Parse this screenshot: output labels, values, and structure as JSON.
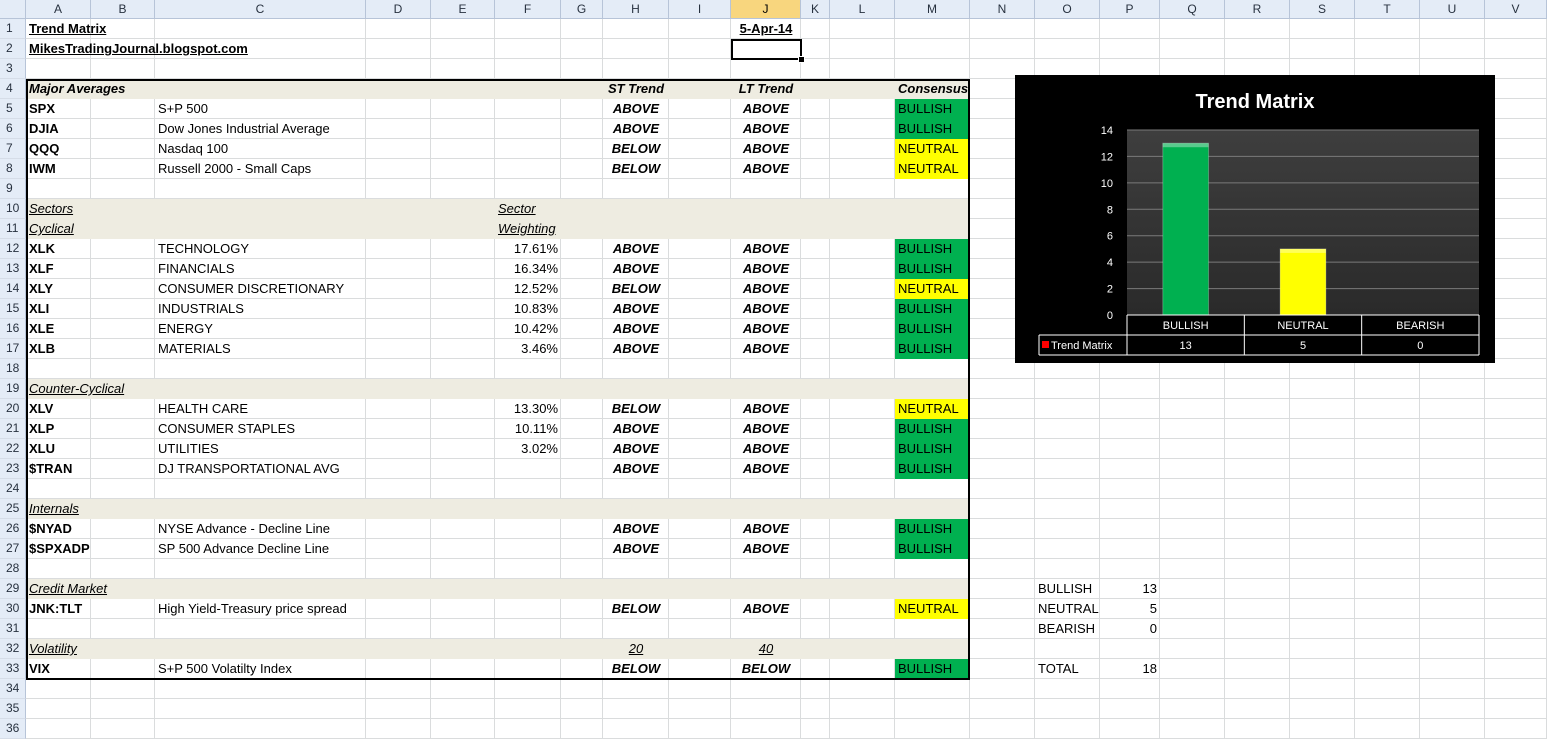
{
  "columns": [
    "A",
    "B",
    "C",
    "D",
    "E",
    "F",
    "G",
    "H",
    "I",
    "J",
    "K",
    "L",
    "M",
    "N",
    "O",
    "P",
    "Q",
    "R",
    "S",
    "T",
    "U",
    "V"
  ],
  "selected_column": "J",
  "rows": [
    "1",
    "2",
    "3",
    "4",
    "5",
    "6",
    "7",
    "8",
    "9",
    "10",
    "11",
    "12",
    "13",
    "14",
    "15",
    "16",
    "17",
    "18",
    "19",
    "20",
    "21",
    "22",
    "23",
    "24",
    "25",
    "26",
    "27",
    "28",
    "29",
    "30",
    "31",
    "32",
    "33",
    "34",
    "35",
    "36"
  ],
  "title": "Trend Matrix",
  "blog": "MikesTradingJournal.blogspot.com",
  "date": "5-Apr-14",
  "headers": {
    "major_averages": "Major Averages",
    "st_trend": "ST Trend",
    "lt_trend": "LT Trend",
    "consensus": "Consensus",
    "sectors": "Sectors",
    "sector": "Sector",
    "cyclical": "Cyclical",
    "weighting": "Weighting",
    "counter_cyclical": "Counter-Cyclical",
    "internals": "Internals",
    "credit_market": "Credit Market",
    "volatility": "Volatility",
    "vol_st": "20",
    "vol_lt": "40"
  },
  "major": [
    {
      "ticker": "SPX",
      "name": "S+P 500",
      "st": "ABOVE",
      "lt": "ABOVE",
      "consensus": "BULLISH"
    },
    {
      "ticker": "DJIA",
      "name": "Dow Jones Industrial Average",
      "st": "ABOVE",
      "lt": "ABOVE",
      "consensus": "BULLISH"
    },
    {
      "ticker": "QQQ",
      "name": "Nasdaq 100",
      "st": "BELOW",
      "lt": "ABOVE",
      "consensus": "NEUTRAL"
    },
    {
      "ticker": "IWM",
      "name": "Russell 2000 - Small Caps",
      "st": "BELOW",
      "lt": "ABOVE",
      "consensus": "NEUTRAL"
    }
  ],
  "cyclical": [
    {
      "ticker": "XLK",
      "name": "TECHNOLOGY",
      "weight": "17.61%",
      "st": "ABOVE",
      "lt": "ABOVE",
      "consensus": "BULLISH"
    },
    {
      "ticker": "XLF",
      "name": "FINANCIALS",
      "weight": "16.34%",
      "st": "ABOVE",
      "lt": "ABOVE",
      "consensus": "BULLISH"
    },
    {
      "ticker": "XLY",
      "name": "CONSUMER DISCRETIONARY",
      "weight": "12.52%",
      "st": "BELOW",
      "lt": "ABOVE",
      "consensus": "NEUTRAL"
    },
    {
      "ticker": "XLI",
      "name": "INDUSTRIALS",
      "weight": "10.83%",
      "st": "ABOVE",
      "lt": "ABOVE",
      "consensus": "BULLISH"
    },
    {
      "ticker": "XLE",
      "name": "ENERGY",
      "weight": "10.42%",
      "st": "ABOVE",
      "lt": "ABOVE",
      "consensus": "BULLISH"
    },
    {
      "ticker": "XLB",
      "name": "MATERIALS",
      "weight": "3.46%",
      "st": "ABOVE",
      "lt": "ABOVE",
      "consensus": "BULLISH"
    }
  ],
  "counter": [
    {
      "ticker": "XLV",
      "name": "HEALTH CARE",
      "weight": "13.30%",
      "st": "BELOW",
      "lt": "ABOVE",
      "consensus": "NEUTRAL"
    },
    {
      "ticker": "XLP",
      "name": "CONSUMER STAPLES",
      "weight": "10.11%",
      "st": "ABOVE",
      "lt": "ABOVE",
      "consensus": "BULLISH"
    },
    {
      "ticker": "XLU",
      "name": "UTILITIES",
      "weight": "3.02%",
      "st": "ABOVE",
      "lt": "ABOVE",
      "consensus": "BULLISH"
    },
    {
      "ticker": "$TRAN",
      "name": "DJ TRANSPORTATIONAL AVG",
      "weight": "",
      "st": "ABOVE",
      "lt": "ABOVE",
      "consensus": "BULLISH"
    }
  ],
  "internals": [
    {
      "ticker": "$NYAD",
      "name": "NYSE Advance - Decline Line",
      "st": "ABOVE",
      "lt": "ABOVE",
      "consensus": "BULLISH"
    },
    {
      "ticker": "$SPXADP",
      "name": "SP 500 Advance Decline Line",
      "st": "ABOVE",
      "lt": "ABOVE",
      "consensus": "BULLISH"
    }
  ],
  "credit": [
    {
      "ticker": "JNK:TLT",
      "name": "High Yield-Treasury price spread",
      "st": "BELOW",
      "lt": "ABOVE",
      "consensus": "NEUTRAL"
    }
  ],
  "volatility": [
    {
      "ticker": "VIX",
      "name": "S+P 500 Volatilty Index",
      "st": "BELOW",
      "lt": "BELOW",
      "consensus": "BULLISH"
    }
  ],
  "summary": {
    "bullish_label": "BULLISH",
    "bullish": "13",
    "neutral_label": "NEUTRAL",
    "neutral": "5",
    "bearish_label": "BEARISH",
    "bearish": "0",
    "total_label": "TOTAL",
    "total": "18"
  },
  "colors": {
    "bullish": "#00b050",
    "neutral": "#ffff00",
    "band": "#eeece1"
  },
  "chart_data": {
    "type": "bar",
    "title": "Trend Matrix",
    "categories": [
      "BULLISH",
      "NEUTRAL",
      "BEARISH"
    ],
    "series": [
      {
        "name": "Trend Matrix",
        "values": [
          13,
          5,
          0
        ],
        "colors": [
          "#00b050",
          "#ffff00",
          "#ff0000"
        ]
      }
    ],
    "ylim": [
      0,
      14
    ],
    "yticks": [
      "0",
      "2",
      "4",
      "6",
      "8",
      "10",
      "12",
      "14"
    ],
    "data_table": true,
    "grid": true,
    "background": "#000000"
  }
}
